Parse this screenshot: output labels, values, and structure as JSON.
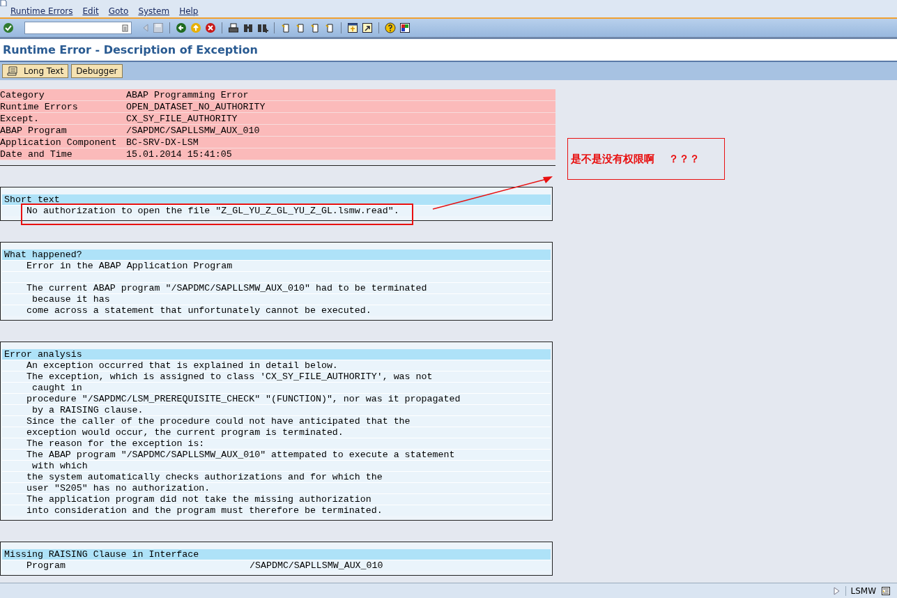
{
  "menu": [
    "Runtime Errors",
    "Edit",
    "Goto",
    "System",
    "Help"
  ],
  "title": "Runtime Error - Description of Exception",
  "app_toolbar": [
    {
      "label": "Long Text",
      "kind": "icon"
    },
    {
      "label": "Debugger",
      "kind": "plain"
    }
  ],
  "header_rows": [
    {
      "label": "Category",
      "value": "ABAP Programming Error"
    },
    {
      "label": "Runtime Errors",
      "value": "OPEN_DATASET_NO_AUTHORITY"
    },
    {
      "label": "Except.",
      "value": "CX_SY_FILE_AUTHORITY"
    },
    {
      "label": "ABAP Program",
      "value": "/SAPDMC/SAPLLSMW_AUX_010"
    },
    {
      "label": "Application Component",
      "value": "BC-SRV-DX-LSM"
    },
    {
      "label": "Date and Time",
      "value": "15.01.2014 15:41:05"
    }
  ],
  "sections": [
    {
      "heading": "Short text",
      "lines": [
        {
          "text": "No authorization to open the file \"Z_GL_YU_Z_GL_YU_Z_GL.lsmw.read\"."
        }
      ]
    },
    {
      "heading": "What happened?",
      "lines": [
        {
          "text": "Error in the ABAP Application Program",
          "blank_row_after": true
        },
        {
          "text": "The current ABAP program \"/SAPDMC/SAPLLSMW_AUX_010\" had to be terminated"
        },
        {
          "text": " because it has"
        },
        {
          "text": "come across a statement that unfortunately cannot be executed."
        }
      ]
    },
    {
      "heading": "Error analysis",
      "lines": [
        {
          "text": "An exception occurred that is explained in detail below."
        },
        {
          "text": "The exception, which is assigned to class 'CX_SY_FILE_AUTHORITY', was not"
        },
        {
          "text": " caught in"
        },
        {
          "text": "procedure \"/SAPDMC/LSM_PREREQUISITE_CHECK\" \"(FUNCTION)\", nor was it propagated"
        },
        {
          "text": " by a RAISING clause."
        },
        {
          "text": "Since the caller of the procedure could not have anticipated that the"
        },
        {
          "text": "exception would occur, the current program is terminated."
        },
        {
          "text": "The reason for the exception is:"
        },
        {
          "text": "The ABAP program \"/SAPDMC/SAPLLSMW_AUX_010\" attempated to execute a statement"
        },
        {
          "text": " with which"
        },
        {
          "text": "the system automatically checks authorizations and for which the"
        },
        {
          "text": "user \"S205\" has no authorization."
        },
        {
          "text": "The application program did not take the missing authorization"
        },
        {
          "text": "into consideration and the program must therefore be terminated."
        }
      ]
    },
    {
      "heading": "Missing RAISING Clause in Interface",
      "lines": [
        {
          "text": "Program",
          "value": "/SAPDMC/SAPLLSMW_AUX_010"
        }
      ]
    }
  ],
  "annotation": {
    "note": "是不是没有权限啊",
    "marks": "？？？"
  },
  "status_bar": {
    "transaction": "LSMW"
  }
}
